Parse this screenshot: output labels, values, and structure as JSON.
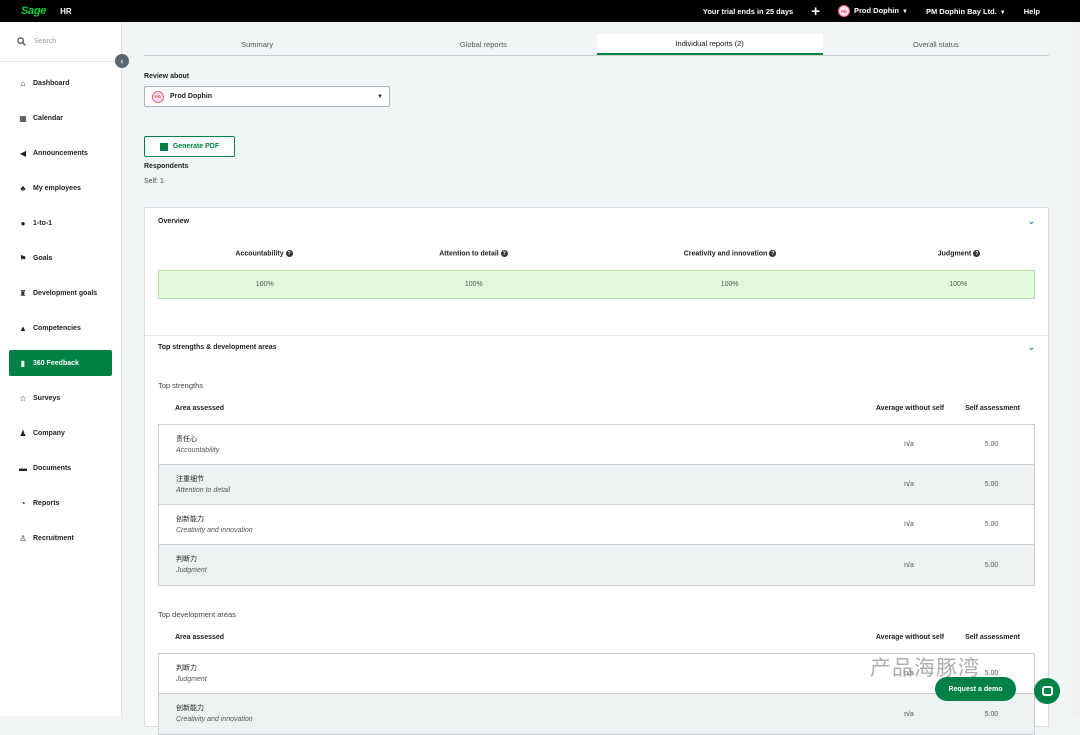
{
  "topbar": {
    "brand": "Sage",
    "product": "HR",
    "trial": "Your trial ends in 25 days",
    "user": "Prod Dophin",
    "company": "PM Dophin Bay Ltd.",
    "help": "Help"
  },
  "sidebar": {
    "search_placeholder": "Search",
    "items": [
      {
        "label": "Dashboard",
        "icon": "home-icon",
        "glyph": "⌂"
      },
      {
        "label": "Calendar",
        "icon": "calendar-icon",
        "glyph": "▦"
      },
      {
        "label": "Announcements",
        "icon": "megaphone-icon",
        "glyph": "◀"
      },
      {
        "label": "My employees",
        "icon": "org-chart-icon",
        "glyph": "♣"
      },
      {
        "label": "1-to-1",
        "icon": "chat-icon",
        "glyph": "●"
      },
      {
        "label": "Goals",
        "icon": "flag-icon",
        "glyph": "⚑"
      },
      {
        "label": "Development goals",
        "icon": "trophy-icon",
        "glyph": "♜"
      },
      {
        "label": "Competencies",
        "icon": "graduation-cap-icon",
        "glyph": "▲"
      },
      {
        "label": "360 Feedback",
        "icon": "clipboard-icon",
        "glyph": "▮",
        "active": true
      },
      {
        "label": "Surveys",
        "icon": "star-icon",
        "glyph": "☆"
      },
      {
        "label": "Company",
        "icon": "users-icon",
        "glyph": "♟"
      },
      {
        "label": "Documents",
        "icon": "folder-icon",
        "glyph": "▬"
      },
      {
        "label": "Reports",
        "icon": "pie-chart-icon",
        "glyph": "◔"
      },
      {
        "label": "Recruitment",
        "icon": "user-plus-icon",
        "glyph": "♙"
      }
    ]
  },
  "tabs": [
    {
      "label": "Summary"
    },
    {
      "label": "Global reports"
    },
    {
      "label": "Individual reports (2)",
      "active": true
    },
    {
      "label": "Overall status"
    }
  ],
  "review": {
    "label": "Review about",
    "selected": "Prod Dophin"
  },
  "generate_pdf": "Generate PDF",
  "respondents": {
    "label": "Respondents",
    "value": "Self: 1"
  },
  "overview": {
    "title": "Overview",
    "columns": [
      {
        "name": "Accountability",
        "value": "100%"
      },
      {
        "name": "Attention to detail",
        "value": "100%"
      },
      {
        "name": "Creativity and innovation",
        "value": "100%"
      },
      {
        "name": "Judgment",
        "value": "100%"
      }
    ]
  },
  "strengths_section": {
    "title": "Top strengths & development areas"
  },
  "top_strengths": {
    "title": "Top strengths",
    "headers": {
      "area": "Area assessed",
      "avg": "Average without self",
      "self": "Self assessment"
    },
    "rows": [
      {
        "cn": "责任心",
        "en": "Accountability",
        "avg": "n/a",
        "self": "5.00"
      },
      {
        "cn": "注重细节",
        "en": "Attention to detail",
        "avg": "n/a",
        "self": "5.00"
      },
      {
        "cn": "创新能力",
        "en": "Creativity and innovation",
        "avg": "n/a",
        "self": "5.00"
      },
      {
        "cn": "判断力",
        "en": "Judgment",
        "avg": "n/a",
        "self": "5.00"
      }
    ]
  },
  "top_development": {
    "title": "Top development areas",
    "headers": {
      "area": "Area assessed",
      "avg": "Average without self",
      "self": "Self assessment"
    },
    "rows": [
      {
        "cn": "判断力",
        "en": "Judgment",
        "avg": "n/a",
        "self": "5.00"
      },
      {
        "cn": "创新能力",
        "en": "Creativity and innovation",
        "avg": "n/a",
        "self": "5.00"
      }
    ]
  },
  "watermark": "产品海豚湾",
  "request_demo": "Request a demo",
  "colors": {
    "accent": "#008146",
    "topbar": "#000000",
    "overview_bg": "#e3f7d9"
  }
}
